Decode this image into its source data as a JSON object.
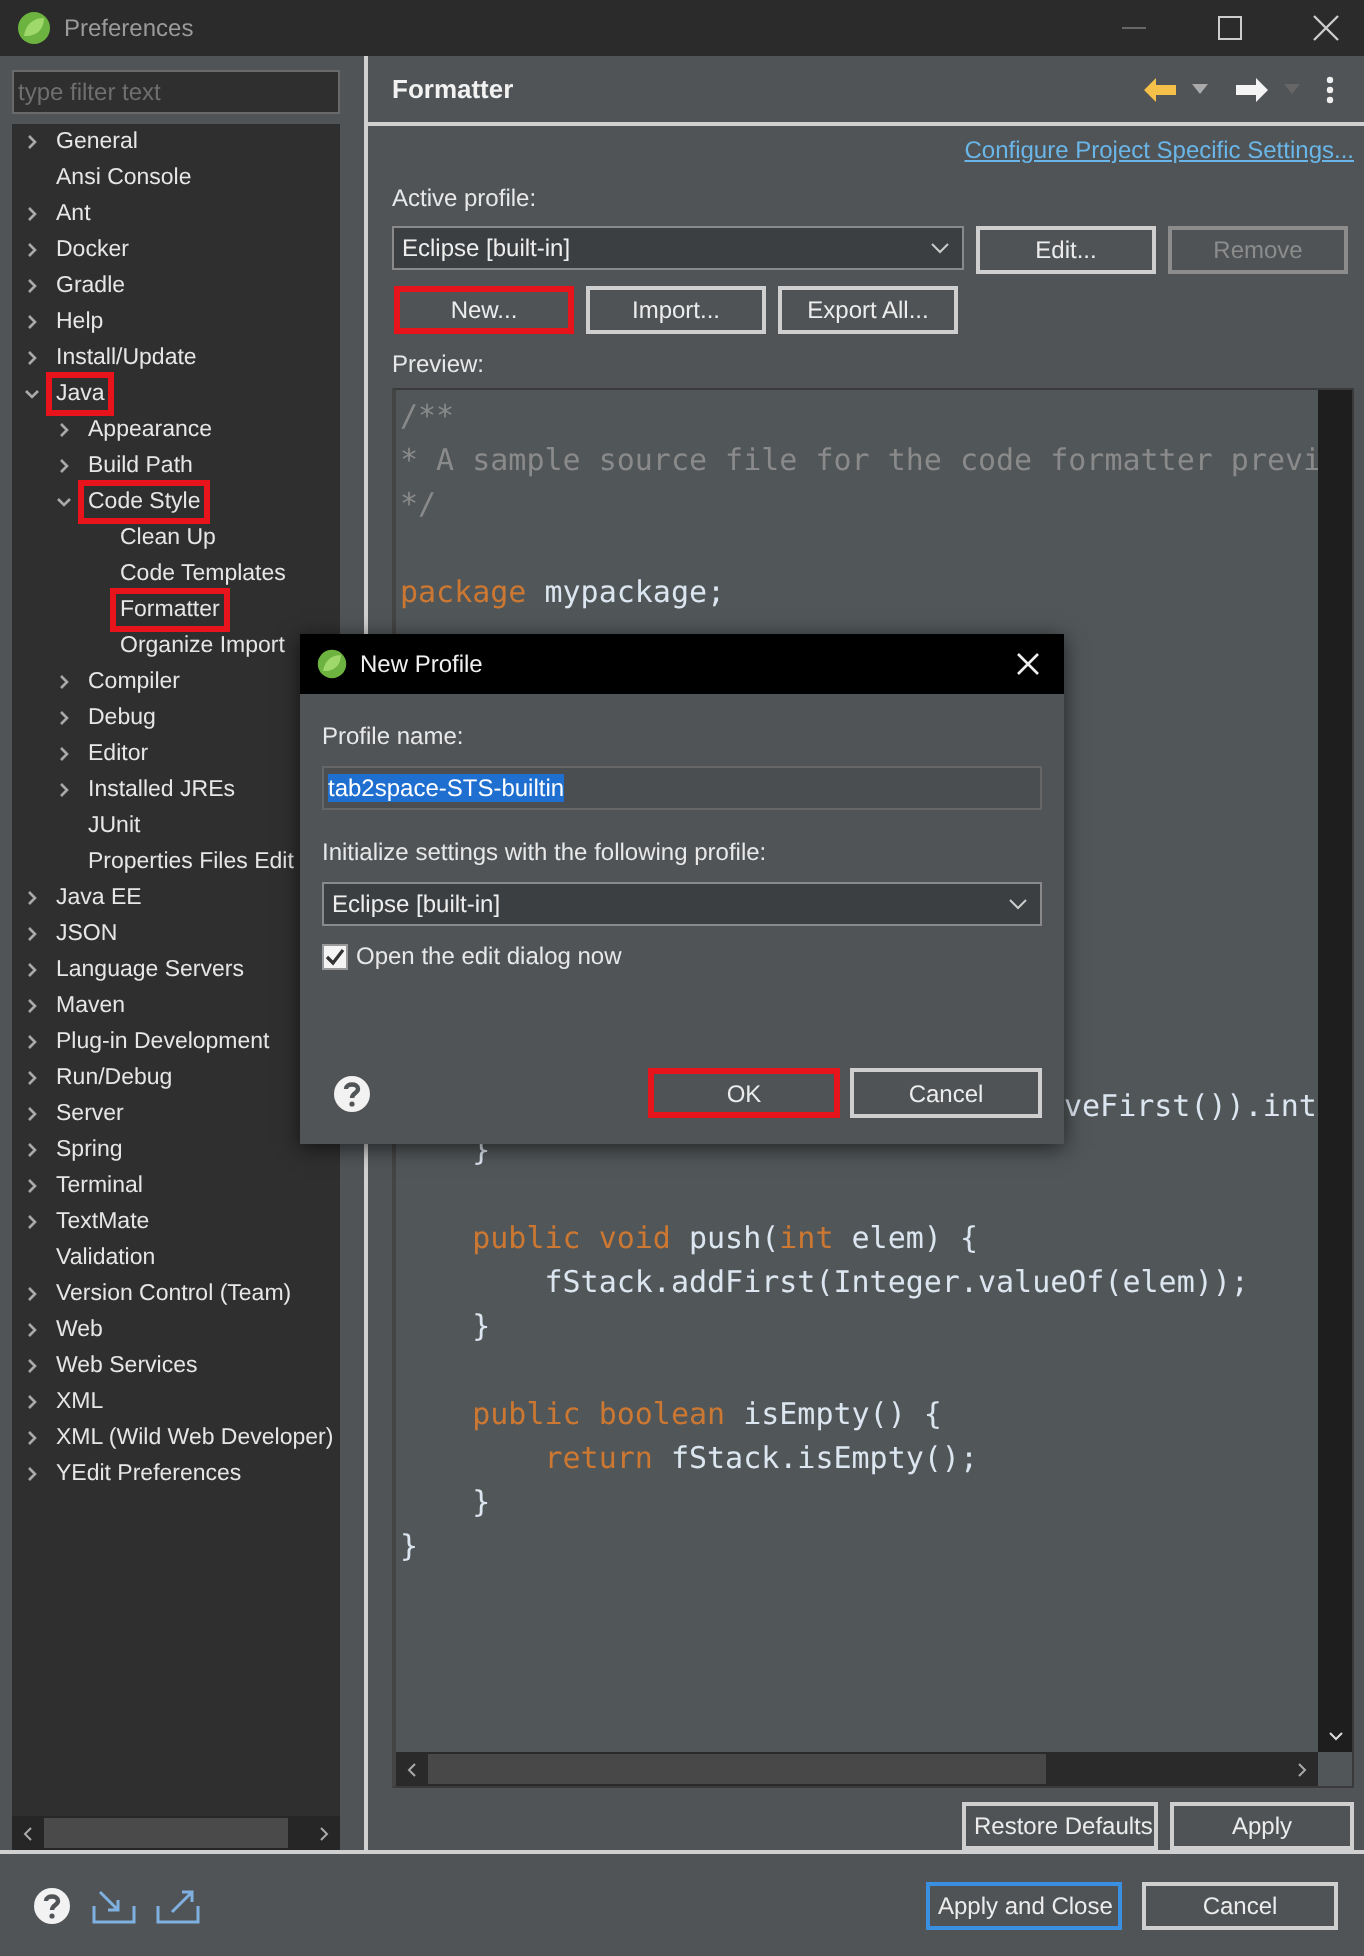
{
  "window": {
    "title": "Preferences"
  },
  "sidebar": {
    "filter": {
      "placeholder": "type filter text"
    },
    "tree": [
      {
        "label": "General",
        "expanded": false,
        "highlighted": false
      },
      {
        "label": "Ansi Console",
        "highlighted": false
      },
      {
        "label": "Ant",
        "expanded": false,
        "highlighted": false
      },
      {
        "label": "Docker",
        "expanded": false,
        "highlighted": false
      },
      {
        "label": "Gradle",
        "expanded": false,
        "highlighted": false
      },
      {
        "label": "Help",
        "expanded": false,
        "highlighted": false
      },
      {
        "label": "Install/Update",
        "expanded": false,
        "highlighted": false
      },
      {
        "label": "Java",
        "expanded": true,
        "highlighted": true,
        "children": [
          {
            "label": "Appearance",
            "expanded": false,
            "highlighted": false
          },
          {
            "label": "Build Path",
            "expanded": false,
            "highlighted": false
          },
          {
            "label": "Code Style",
            "expanded": true,
            "highlighted": true,
            "children": [
              {
                "label": "Clean Up",
                "highlighted": false
              },
              {
                "label": "Code Templates",
                "highlighted": false
              },
              {
                "label": "Formatter",
                "highlighted": true
              },
              {
                "label": "Organize Import",
                "highlighted": false
              }
            ]
          },
          {
            "label": "Compiler",
            "expanded": false,
            "highlighted": false
          },
          {
            "label": "Debug",
            "expanded": false,
            "highlighted": false
          },
          {
            "label": "Editor",
            "expanded": false,
            "highlighted": false
          },
          {
            "label": "Installed JREs",
            "expanded": false,
            "highlighted": false
          },
          {
            "label": "JUnit",
            "highlighted": false
          },
          {
            "label": "Properties Files Edit",
            "highlighted": false
          }
        ]
      },
      {
        "label": "Java EE",
        "expanded": false,
        "highlighted": false
      },
      {
        "label": "JSON",
        "expanded": false,
        "highlighted": false
      },
      {
        "label": "Language Servers",
        "expanded": false,
        "highlighted": false
      },
      {
        "label": "Maven",
        "expanded": false,
        "highlighted": false
      },
      {
        "label": "Plug-in Development",
        "expanded": false,
        "highlighted": false
      },
      {
        "label": "Run/Debug",
        "expanded": false,
        "highlighted": false
      },
      {
        "label": "Server",
        "expanded": false,
        "highlighted": false
      },
      {
        "label": "Spring",
        "expanded": false,
        "highlighted": false
      },
      {
        "label": "Terminal",
        "expanded": false,
        "highlighted": false
      },
      {
        "label": "TextMate",
        "expanded": false,
        "highlighted": false
      },
      {
        "label": "Validation",
        "highlighted": false
      },
      {
        "label": "Version Control (Team)",
        "expanded": false,
        "highlighted": false
      },
      {
        "label": "Web",
        "expanded": false,
        "highlighted": false
      },
      {
        "label": "Web Services",
        "expanded": false,
        "highlighted": false
      },
      {
        "label": "XML",
        "expanded": false,
        "highlighted": false
      },
      {
        "label": "XML (Wild Web Developer)",
        "expanded": false,
        "highlighted": false
      },
      {
        "label": "YEdit Preferences",
        "expanded": false,
        "highlighted": false
      }
    ]
  },
  "page": {
    "title": "Formatter",
    "link": "Configure Project Specific Settings...",
    "active_profile_label": "Active profile:",
    "profile_combo": "Eclipse [built-in]",
    "buttons": [
      {
        "label": "Edit...",
        "disabled": false,
        "highlighted": false
      },
      {
        "label": "Remove",
        "disabled": true,
        "highlighted": false
      },
      {
        "label": "New...",
        "disabled": false,
        "highlighted": true
      },
      {
        "label": "Import...",
        "disabled": false,
        "highlighted": false
      },
      {
        "label": "Export All...",
        "disabled": false,
        "highlighted": false
      }
    ],
    "preview_label": "Preview:",
    "preview_top": [
      {
        "lines": [
          {
            "tokens": [
              {
                "kind": "comment",
                "text": "/**"
              }
            ]
          },
          {
            "tokens": [
              {
                "kind": "comment",
                "text": "* A sample source file for the code formatter previ"
              }
            ]
          },
          {
            "tokens": [
              {
                "kind": "comment",
                "text": "*/"
              }
            ]
          }
        ]
      },
      {
        "lines": [
          {
            "tokens": [
              {
                "kind": "keyword",
                "text": "package"
              },
              {
                "kind": "plain",
                "text": " mypackage;"
              }
            ]
          }
        ]
      }
    ],
    "preview_fragment": "veFirst()).int",
    "preview_bottom": [
      {
        "lines": [
          {
            "tokens": [
              {
                "kind": "plain",
                "text": "    }"
              }
            ]
          }
        ]
      },
      {
        "lines": [
          {
            "tokens": [
              {
                "kind": "keyword",
                "text": "    public void"
              },
              {
                "kind": "plain",
                "text": " push("
              },
              {
                "kind": "keyword",
                "text": "int"
              },
              {
                "kind": "plain",
                "text": " elem) {"
              }
            ]
          },
          {
            "tokens": [
              {
                "kind": "plain",
                "text": "        fStack.addFirst(Integer.valueOf(elem));"
              }
            ]
          },
          {
            "tokens": [
              {
                "kind": "plain",
                "text": "    }"
              }
            ]
          }
        ]
      },
      {
        "lines": [
          {
            "tokens": [
              {
                "kind": "keyword",
                "text": "    public boolean"
              },
              {
                "kind": "plain",
                "text": " isEmpty() {"
              }
            ]
          },
          {
            "tokens": [
              {
                "kind": "keyword",
                "text": "        return"
              },
              {
                "kind": "plain",
                "text": " fStack.isEmpty();"
              }
            ]
          },
          {
            "tokens": [
              {
                "kind": "plain",
                "text": "    }"
              }
            ]
          },
          {
            "tokens": [
              {
                "kind": "plain",
                "text": "}"
              }
            ]
          }
        ]
      }
    ],
    "bottom_buttons": [
      "Restore Defaults",
      "Apply"
    ]
  },
  "footer": {
    "buttons": [
      {
        "label": "Apply and Close",
        "default": true
      },
      {
        "label": "Cancel",
        "default": false
      }
    ]
  },
  "dialog": {
    "title": "New Profile",
    "name_label": "Profile name:",
    "name_value": "tab2space-STS-builtin",
    "name_selected": true,
    "init_label": "Initialize settings with the following profile:",
    "init_combo": "Eclipse [built-in]",
    "checkbox": {
      "label": "Open the edit dialog now",
      "checked": true
    },
    "buttons": [
      {
        "label": "OK",
        "highlighted": true
      },
      {
        "label": "Cancel",
        "highlighted": false
      }
    ]
  }
}
